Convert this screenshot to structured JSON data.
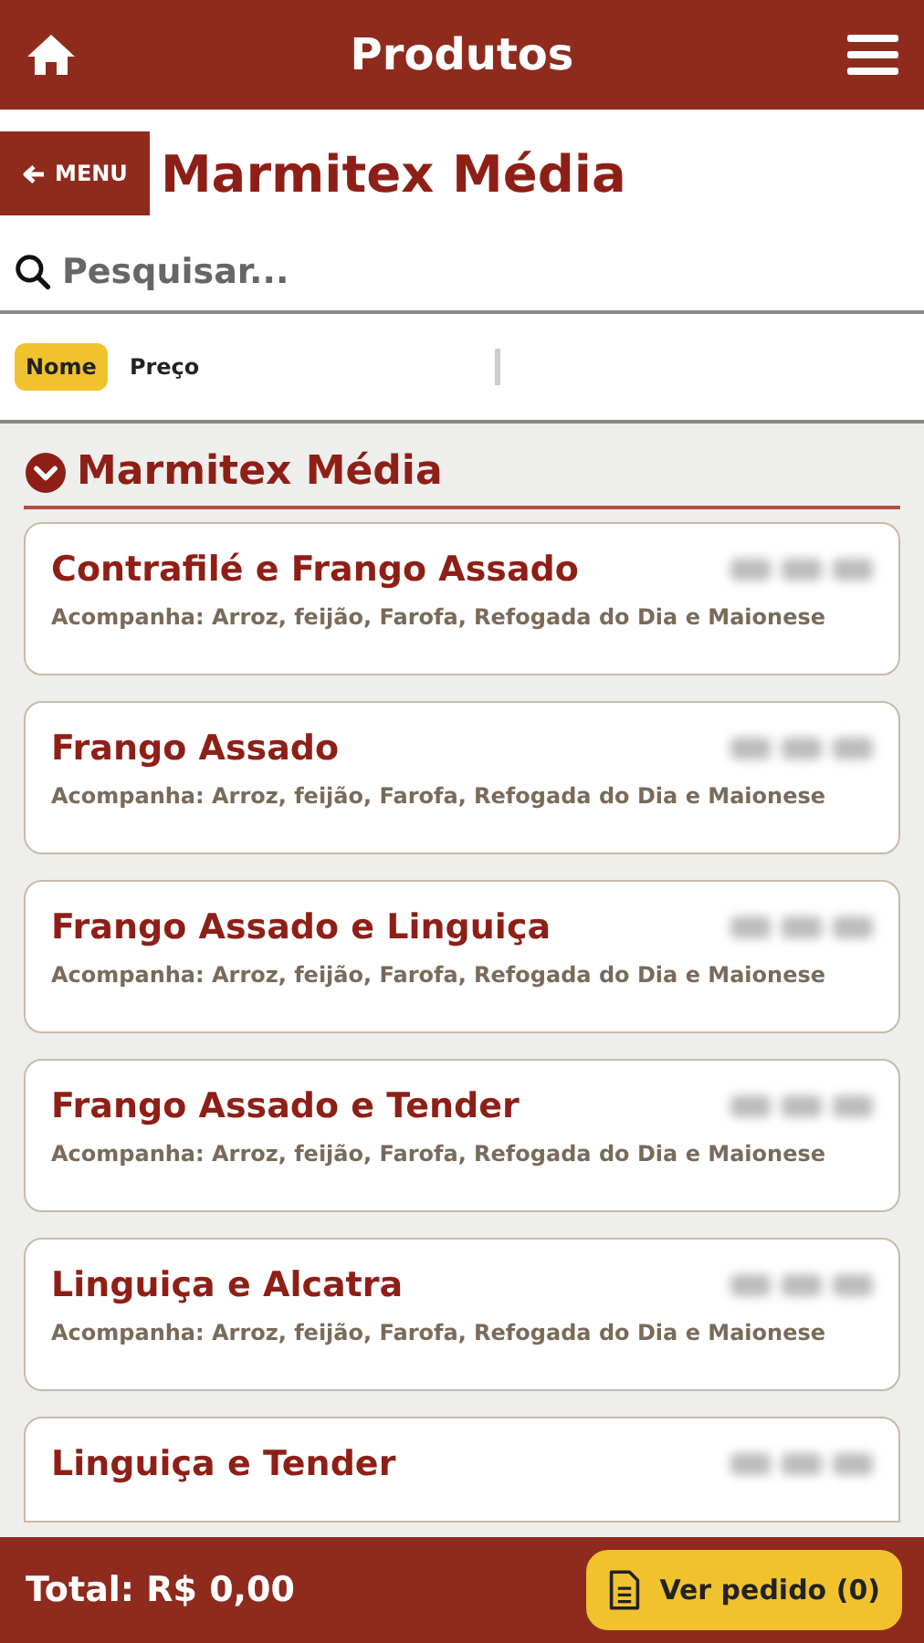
{
  "header": {
    "title": "Produtos"
  },
  "back_button": {
    "label": "MENU"
  },
  "page_title": "Marmitex Média",
  "search": {
    "placeholder": "Pesquisar..."
  },
  "sort_options": [
    {
      "label": "Nome",
      "selected": true
    },
    {
      "label": "Preço",
      "selected": false
    }
  ],
  "section": {
    "title": "Marmitex Média",
    "expanded": true
  },
  "products": [
    {
      "name": "Contrafilé e Frango Assado",
      "description": "Acompanha: Arroz, feijão, Farofa, Refogada do Dia e Maionese"
    },
    {
      "name": "Frango Assado",
      "description": "Acompanha: Arroz, feijão, Farofa, Refogada do Dia e Maionese"
    },
    {
      "name": "Frango Assado e Linguiça",
      "description": "Acompanha: Arroz, feijão, Farofa, Refogada do Dia e Maionese"
    },
    {
      "name": "Frango Assado e Tender",
      "description": "Acompanha: Arroz, feijão, Farofa, Refogada do Dia e Maionese"
    },
    {
      "name": "Linguiça e Alcatra",
      "description": "Acompanha: Arroz, feijão, Farofa, Refogada do Dia e Maionese"
    },
    {
      "name": "Linguiça e Tender"
    }
  ],
  "footer": {
    "total": "Total: R$ 0,00",
    "order_button": "Ver pedido (0)"
  }
}
